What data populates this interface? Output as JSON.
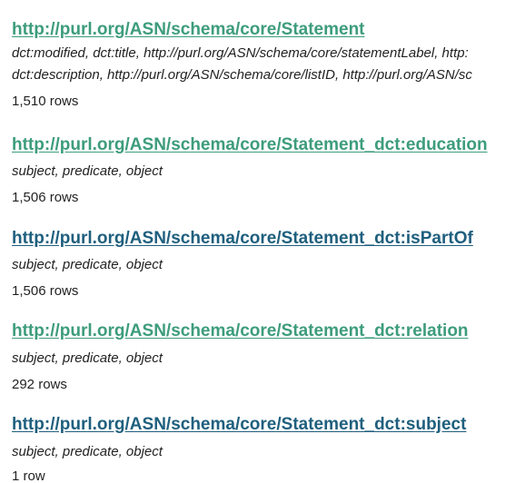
{
  "tables": [
    {
      "name": "http://purl.org/ASN/schema/core/Statement",
      "link_color": "#3d9c7c",
      "columns_lines": [
        "dct:modified, dct:title, http://purl.org/ASN/schema/core/statementLabel, http:",
        "dct:description, http://purl.org/ASN/schema/core/listID, http://purl.org/ASN/sc"
      ],
      "rows": "1,510 rows"
    },
    {
      "name": "http://purl.org/ASN/schema/core/Statement_dct:education",
      "link_color": "#3d9c7c",
      "columns_lines": [
        "subject, predicate, object"
      ],
      "rows": "1,506 rows"
    },
    {
      "name": "http://purl.org/ASN/schema/core/Statement_dct:isPartOf",
      "link_color": "#1f5f7e",
      "columns_lines": [
        "subject, predicate, object"
      ],
      "rows": "1,506 rows"
    },
    {
      "name": "http://purl.org/ASN/schema/core/Statement_dct:relation",
      "link_color": "#3d9c7c",
      "columns_lines": [
        "subject, predicate, object"
      ],
      "rows": "292 rows"
    },
    {
      "name": "http://purl.org/ASN/schema/core/Statement_dct:subject",
      "link_color": "#1f5f7e",
      "columns_lines": [
        "subject, predicate, object"
      ],
      "rows": "1 row"
    }
  ]
}
